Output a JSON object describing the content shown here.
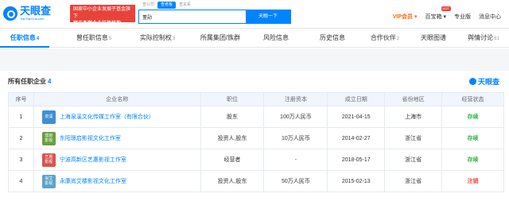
{
  "header": {
    "logo_text": "天眼查",
    "logo_url": "TianYanCha.com",
    "gov_line1": "国家中小企业发展子基金旗下",
    "gov_line2": "官方备案企业征信机构",
    "search_tabs": [
      "查公司",
      "查老板",
      "查关系"
    ],
    "search_active": 1,
    "search_value": "董勋",
    "search_button": "天眼一下",
    "nav": {
      "vip": "VIP会员",
      "vip_arrow": "▾",
      "treasure": "百宝箱",
      "treasure_arrow": "▾",
      "hot": "HOT",
      "pro": "专业版",
      "messages": "消息中心"
    }
  },
  "tabs": [
    {
      "label": "任职信息",
      "count": "4"
    },
    {
      "label": "曾任职信息",
      "count": "5"
    },
    {
      "label": "实际控制权",
      "count": "3"
    },
    {
      "label": "所属集团/族群",
      "count": ""
    },
    {
      "label": "风险信息",
      "count": ""
    },
    {
      "label": "历史信息",
      "count": ""
    },
    {
      "label": "合作伙伴",
      "count": "2"
    },
    {
      "label": "天眼图谱",
      "count": ""
    },
    {
      "label": "舆情讨论",
      "count": "61"
    }
  ],
  "section": {
    "title": "所有任职企业",
    "count": "4",
    "brand": "天眼查"
  },
  "table": {
    "columns": [
      "序号",
      "企业名称",
      "职位",
      "注册资本",
      "成立日期",
      "省份地区",
      "经营状态"
    ],
    "rows": [
      {
        "idx": "1",
        "logo": "泉溪",
        "logo_color": "#3f8fd6",
        "name": "上海泉溪文化传媒工作室（有限合伙）",
        "role": "股东",
        "capital": "100万人民币",
        "date": "2021-04-15",
        "region": "上海市",
        "status": "存续",
        "status_color": "#36b34a"
      },
      {
        "idx": "2",
        "logo": "璟启 影视",
        "logo_color": "#6a9f3f",
        "name": "东阳璟启影视文化工作室",
        "role": "投资人,股东",
        "capital": "10万人民币",
        "date": "2014-02-27",
        "region": "浙江省",
        "status": "存续",
        "status_color": "#36b34a"
      },
      {
        "idx": "3",
        "logo": "艺惠 影视",
        "logo_color": "#d9534f",
        "name": "宁波高新区艺惠影视工作室",
        "role": "经营者",
        "capital": "-",
        "date": "2018-05-17",
        "region": "浙江省",
        "status": "存续",
        "status_color": "#36b34a"
      },
      {
        "idx": "4",
        "logo": "尚艾 影视",
        "logo_color": "#5ba3c9",
        "name": "永康尚艾楼影视文化工作室",
        "role": "投资人,股东",
        "capital": "50万人民币",
        "date": "2015-02-13",
        "region": "浙江省",
        "status": "注销",
        "status_color": "#f5463a"
      }
    ]
  }
}
